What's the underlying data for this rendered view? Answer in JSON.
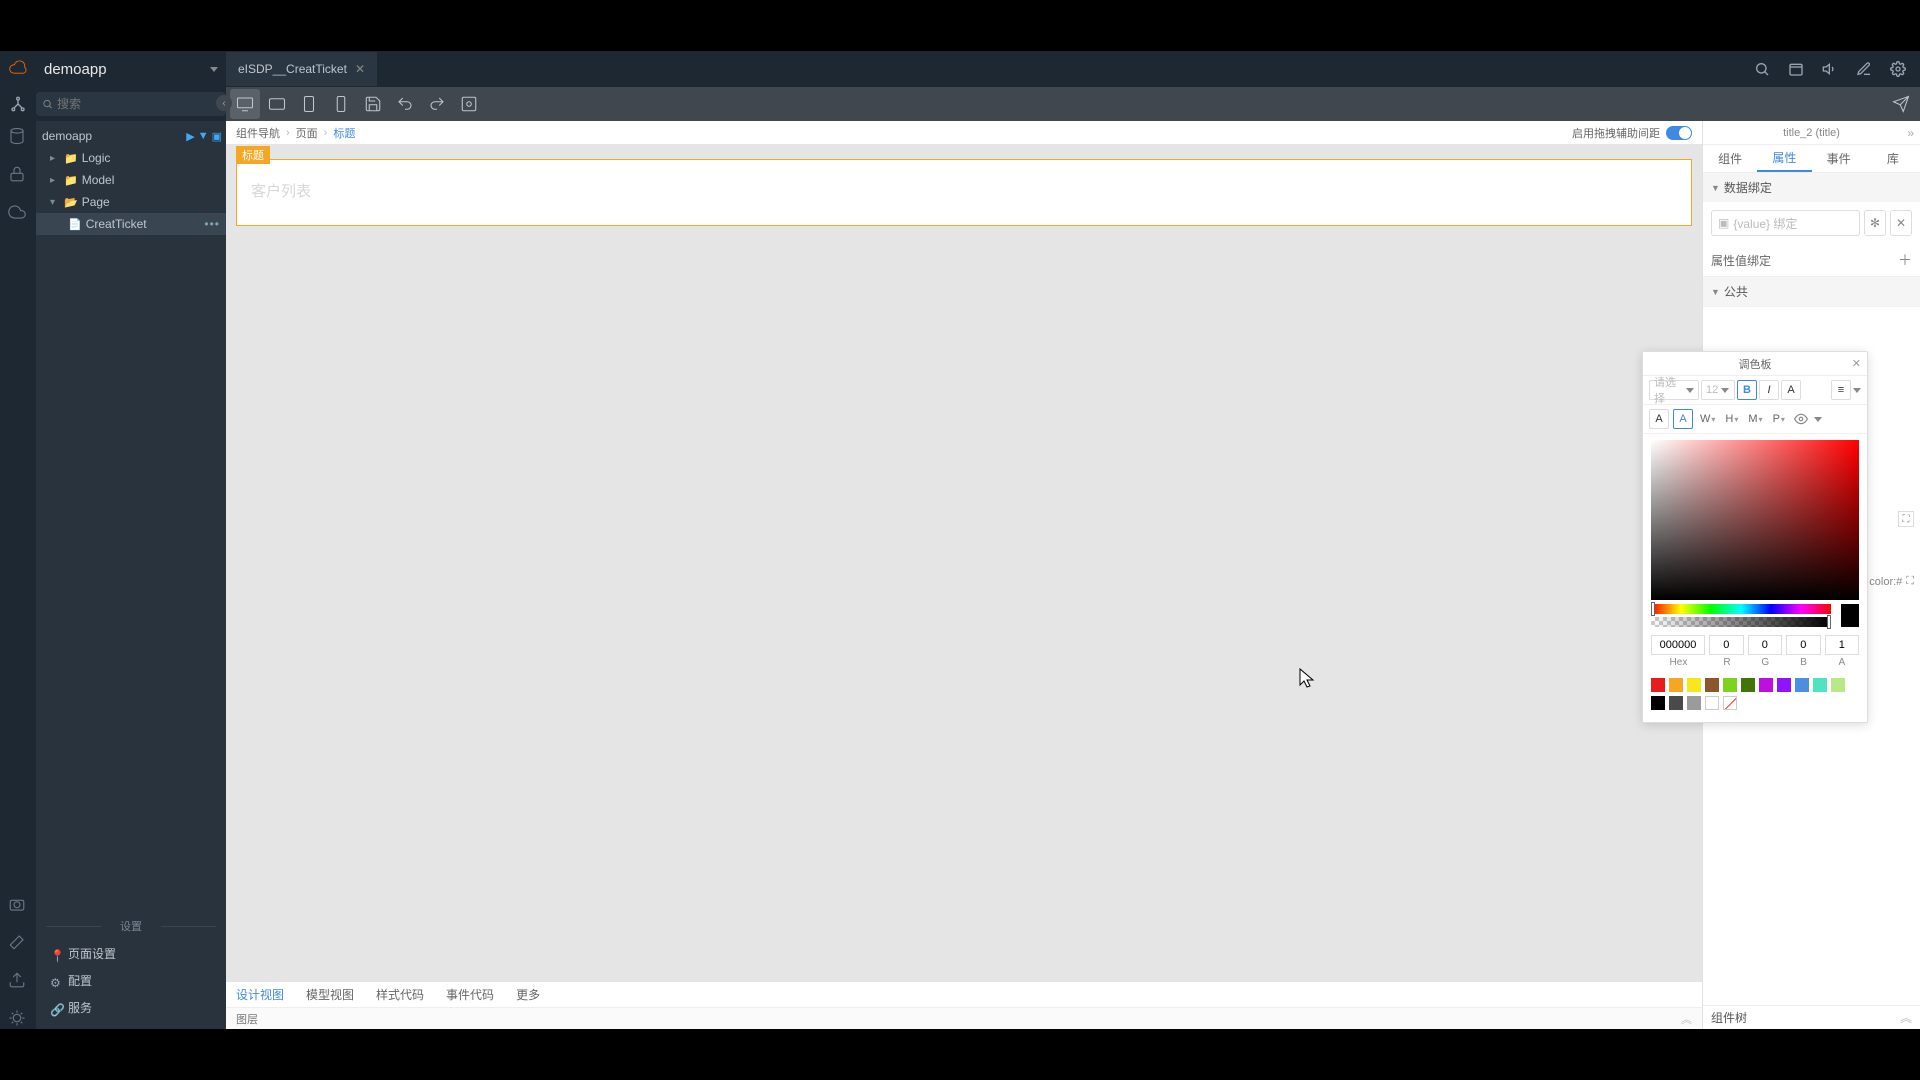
{
  "app": {
    "name": "demoapp"
  },
  "tab": {
    "title": "eISDP__CreatTicket"
  },
  "search": {
    "placeholder": "搜索"
  },
  "tree": {
    "root": "demoapp",
    "folders": [
      "Logic",
      "Model",
      "Page"
    ],
    "file": "CreatTicket"
  },
  "settings": {
    "title": "设置",
    "items": [
      "页面设置",
      "配置",
      "服务"
    ]
  },
  "breadcrumb": {
    "a": "组件导航",
    "b": "页面",
    "c": "标题",
    "toggle_label": "启用拖拽辅助间距"
  },
  "selected_component": {
    "tag": "标题",
    "placeholder": "客户列表"
  },
  "bottom_tabs": [
    "设计视图",
    "模型视图",
    "样式代码",
    "事件代码",
    "更多"
  ],
  "layer_bar": "图层",
  "inspector": {
    "title": "title_2 (title)",
    "tabs": [
      "组件",
      "属性",
      "事件",
      "库"
    ],
    "section_bind": "数据绑定",
    "bind_placeholder": "{value} 绑定",
    "attr_bind": "属性值绑定",
    "section_public": "公共",
    "tree_foot": "组件树"
  },
  "color_panel": {
    "title": "调色板",
    "font_dd": "请选择",
    "font_size": "12",
    "bold": "B",
    "italic": "I",
    "fontcolor": "A",
    "letters": [
      "W",
      "H",
      "M",
      "P"
    ],
    "hex": "000000",
    "r": "0",
    "g": "0",
    "b": "0",
    "a": "1",
    "labels": [
      "Hex",
      "R",
      "G",
      "B",
      "A"
    ],
    "swatches": [
      "#e81c1c",
      "#f5a623",
      "#f8e71c",
      "#8b572a",
      "#7ed321",
      "#417505",
      "#bd10e0",
      "#9013fe",
      "#4a90e2",
      "#50e3c2",
      "#b8e986",
      "#000000",
      "#4a4a4a",
      "#9b9b9b",
      "#ffffff"
    ]
  },
  "behind": {
    "label": "color:#"
  }
}
